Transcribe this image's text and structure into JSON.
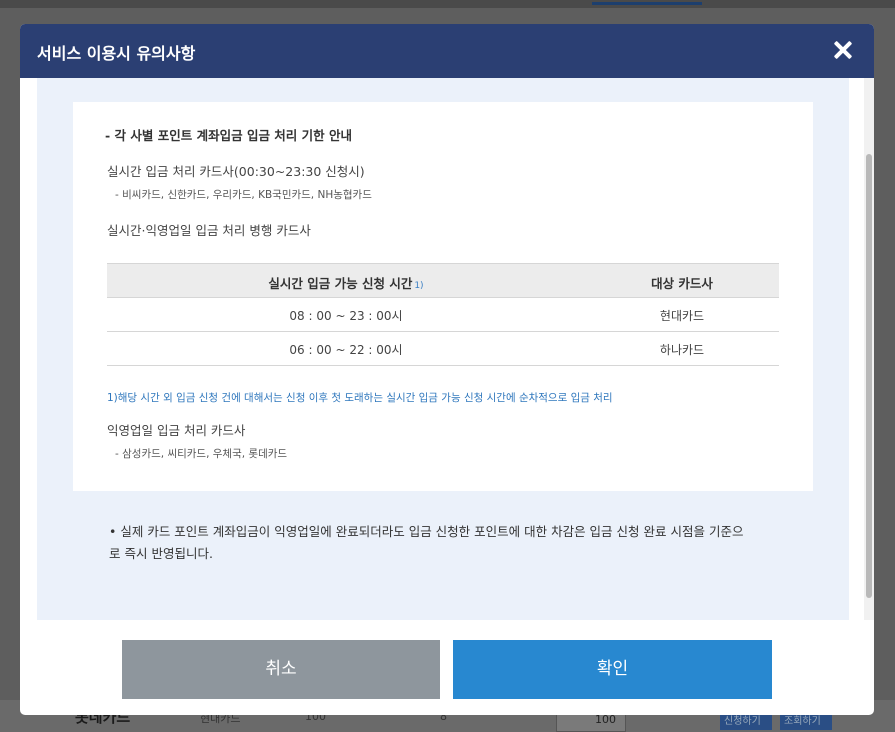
{
  "background": {
    "row_label": "롯데카드",
    "row_cells": [
      "현대카드",
      "100",
      "8"
    ],
    "input_value": "100",
    "button_labels": [
      "신청하기",
      "조회하기"
    ]
  },
  "modal": {
    "title": "서비스 이용시 유의사항",
    "close_icon": "close-icon"
  },
  "content": {
    "section_title": "- 각 사별 포인트 계좌입금 입금 처리 기한 안내",
    "realtime_heading": "실시간 입금 처리 카드사(00:30~23:30 신청시)",
    "realtime_cards": "- 비씨카드, 신한카드, 우리카드, KB국민카드, NH농협카드",
    "bank_heading": "실시간·익영업일 입금 처리 병행 카드사",
    "table": {
      "headers": [
        "실시간 입금 가능 신청 시간",
        "대상 카드사"
      ],
      "header_note": "1)",
      "rows": [
        [
          "08 : 00 ~ 23 : 00시",
          "현대카드"
        ],
        [
          "06 : 00 ~ 22 : 00시",
          "하나카드"
        ]
      ]
    },
    "footnote": "1)해당 시간 외 입금 신청 건에 대해서는 신청 이후 첫 도래하는 실시간 입금 가능 신청 시간에 순차적으로 입금 처리",
    "nextday_heading": "익영업일 입금 처리 카드사",
    "nextday_cards": "- 삼성카드, 씨티카드, 우체국, 롯데카드",
    "notice_line1": "• 실제 카드 포인트 계좌입금이 익영업일에 완료되더라도 입금 신청한 포인트에 대한 차감은 입금 신청 완료 시점을 기준으",
    "notice_line2": "로 즉시 반영됩니다."
  },
  "buttons": {
    "cancel": "취소",
    "confirm": "확인"
  },
  "colors": {
    "header": "#2b3f73",
    "confirm": "#2888d0",
    "cancel": "#8e969d",
    "body_bg": "#ebf1fa",
    "footnote": "#2f77bd"
  }
}
